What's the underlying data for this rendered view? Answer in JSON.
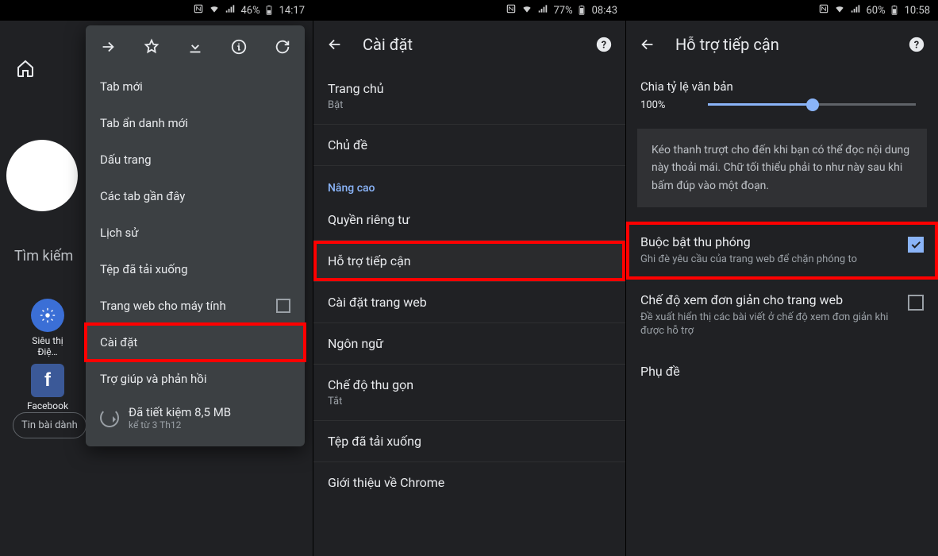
{
  "screen1": {
    "status": {
      "battery_pct": "46%",
      "time": "14:17"
    },
    "search_hint": "Tìm kiếm",
    "tiles": [
      {
        "label": "Siêu thị Điệ…"
      },
      {
        "label": "Facebook"
      }
    ],
    "bottom_pill": "Tin bài dành",
    "menu": {
      "items": [
        "Tab mới",
        "Tab ẩn danh mới",
        "Dấu trang",
        "Các tab gần đây",
        "Lịch sử",
        "Tệp đã tải xuống",
        "Trang web cho máy tính",
        "Cài đặt",
        "Trợ giúp và phản hồi"
      ],
      "saved_primary": "Đã tiết kiệm 8,5 MB",
      "saved_secondary": "kể từ 3 Th12"
    }
  },
  "screen2": {
    "status": {
      "battery_pct": "77%",
      "time": "08:43"
    },
    "title": "Cài đặt",
    "rows": [
      {
        "primary": "Trang chủ",
        "secondary": "Bật"
      },
      {
        "primary": "Chủ đề"
      }
    ],
    "section": "Nâng cao",
    "rows2": [
      {
        "primary": "Quyền riêng tư"
      },
      {
        "primary": "Hỗ trợ tiếp cận",
        "highlight": true
      },
      {
        "primary": "Cài đặt trang web"
      },
      {
        "primary": "Ngôn ngữ"
      },
      {
        "primary": "Chế độ thu gọn",
        "secondary": "Tắt"
      },
      {
        "primary": "Tệp đã tải xuống"
      },
      {
        "primary": "Giới thiệu về Chrome"
      }
    ]
  },
  "screen3": {
    "status": {
      "battery_pct": "60%",
      "time": "10:58"
    },
    "title": "Hỗ trợ tiếp cận",
    "scale": {
      "label": "Chia tỷ lệ văn bản",
      "value": "100%"
    },
    "sample": "Kéo thanh trượt cho đến khi bạn có thể đọc nội dung này thoải mái. Chữ tối thiểu phải to như này sau khi bấm đúp vào một đoạn.",
    "opts": [
      {
        "primary": "Buộc bật thu phóng",
        "secondary": "Ghi đè yêu cầu của trang web để chặn phóng to",
        "checked": true,
        "highlight": true
      },
      {
        "primary": "Chế độ xem đơn giản cho trang web",
        "secondary": "Đề xuất hiển thị các bài viết ở chế độ xem đơn giản khi được hỗ trợ",
        "checked": false
      },
      {
        "primary": "Phụ đề"
      }
    ]
  }
}
